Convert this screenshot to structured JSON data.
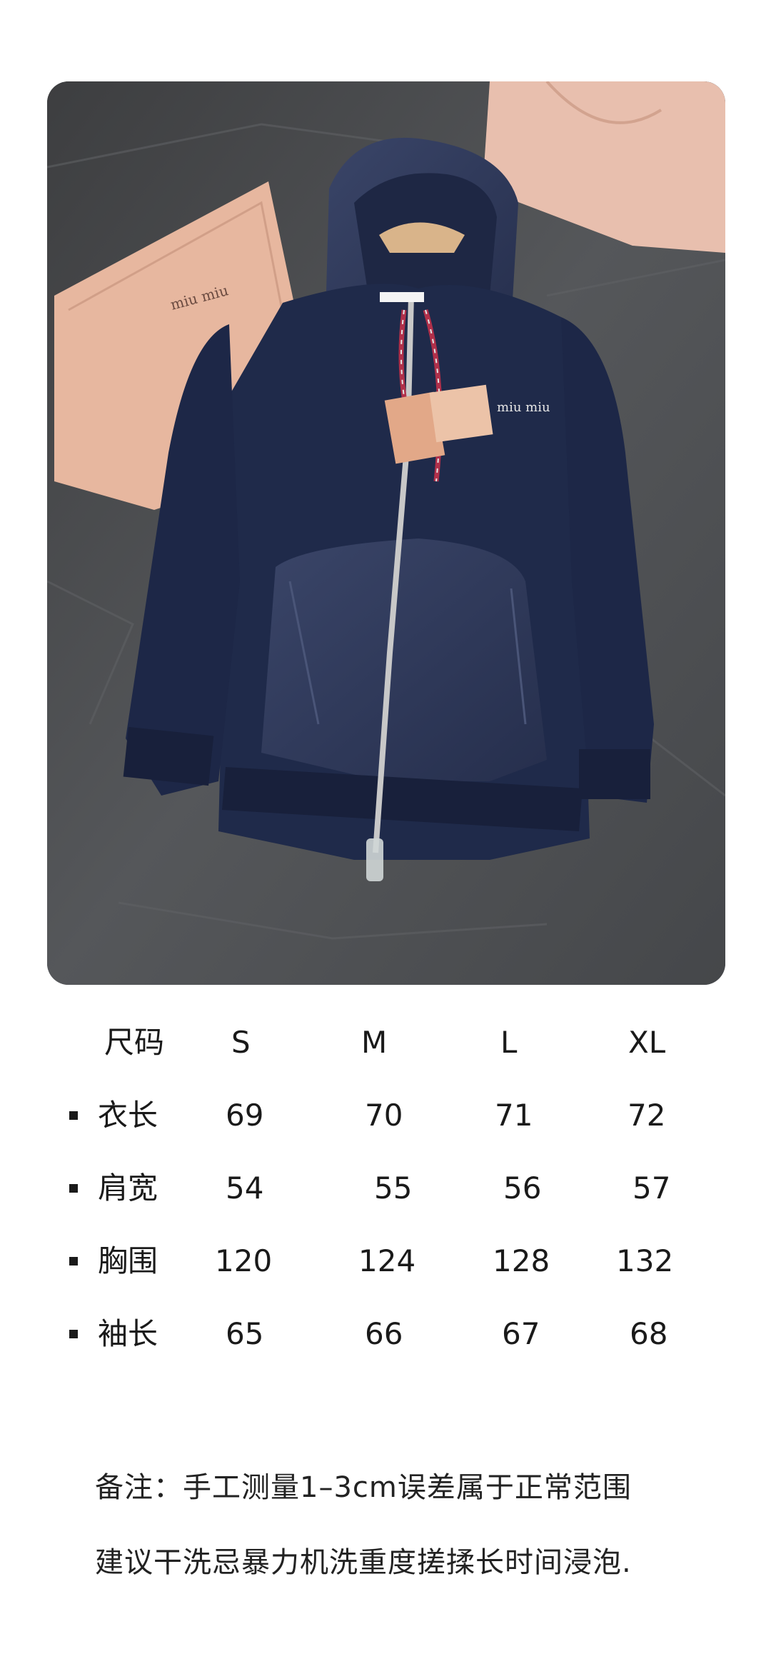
{
  "product_photo": {
    "alt_name": "navy zip-up hoodie photo",
    "logo_text": "miu miu",
    "colors": {
      "hoodie": "#1f2a4a",
      "nylon": "#2f3a5c",
      "background": "#4a4b4d",
      "paper": "#e7b79f"
    }
  },
  "size_table": {
    "header": {
      "label": "尺码",
      "sizes": [
        "S",
        "M",
        "L",
        "XL"
      ]
    },
    "rows": [
      {
        "label": "衣长",
        "values": [
          "69",
          "70",
          "71",
          "72"
        ]
      },
      {
        "label": "肩宽",
        "values": [
          "54",
          "55",
          "56",
          "57"
        ]
      },
      {
        "label": "胸围",
        "values": [
          "120",
          "124",
          "128",
          "132"
        ]
      },
      {
        "label": "袖长",
        "values": [
          "65",
          "66",
          "67",
          "68"
        ]
      }
    ]
  },
  "notes": {
    "line1": "备注：手工测量1–3cm误差属于正常范围",
    "line2": "建议干洗忌暴力机洗重度搓揉长时间浸泡."
  }
}
